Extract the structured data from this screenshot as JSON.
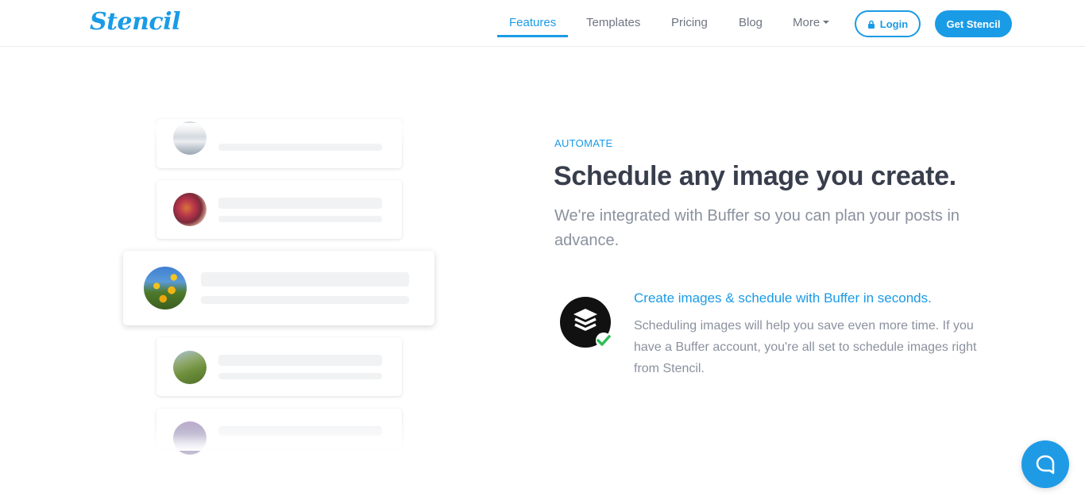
{
  "header": {
    "logo_text": "Stencil",
    "nav": [
      {
        "label": "Features",
        "active": true
      },
      {
        "label": "Templates"
      },
      {
        "label": "Pricing"
      },
      {
        "label": "Blog"
      },
      {
        "label": "More"
      }
    ],
    "login_label": "Login",
    "cta_label": "Get Stencil"
  },
  "main": {
    "eyebrow": "AUTOMATE",
    "headline": "Schedule any image you create.",
    "subhead": "We're integrated with Buffer so you can plan your posts in advance.",
    "feature": {
      "icon": "buffer-layers-check-icon",
      "title": "Create images & schedule with Buffer in seconds.",
      "text": "Scheduling images will help you save even more time. If you have a Buffer account, you're all set to schedule images right from Stencil."
    }
  },
  "illustration": {
    "cards": [
      {
        "image": "snowy-landscape-thumbnail"
      },
      {
        "image": "colorful-scarves-thumbnail"
      },
      {
        "image": "sunflowers-thumbnail",
        "highlighted": true
      },
      {
        "image": "green-hills-thumbnail"
      },
      {
        "image": "city-lights-thumbnail"
      }
    ]
  },
  "colors": {
    "accent": "#1a9be6",
    "headline": "#383e4c",
    "muted": "#8a919e"
  },
  "chat_widget": {
    "icon": "chat-bubble-icon"
  }
}
